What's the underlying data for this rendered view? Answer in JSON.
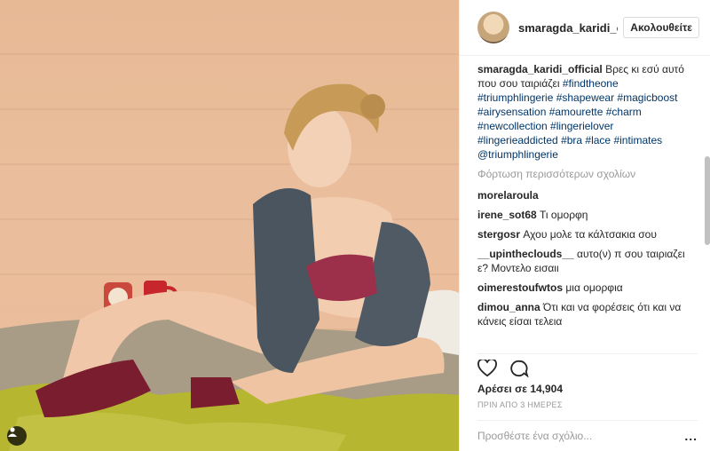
{
  "post": {
    "header": {
      "username": "smaragda_karidi_o",
      "follow_label": "Ακολουθείτε"
    },
    "caption": {
      "username": "smaragda_karidi_official",
      "text": "Βρες κι εσύ αυτό που σου ταιριάζει",
      "tags_line1": "#findtheone",
      "tags_line2": "#triumphlingerie #shapewear #magicboost",
      "tags_line3": "#airysensation #amourette #charm",
      "tags_line4": "#newcollection #lingerielover",
      "tags_line5": "#lingerieaddicted #bra #lace #intimates",
      "tags_line6": "@triumphlingerie"
    },
    "load_more": "Φόρτωση περισσότερων σχολίων",
    "comments": [
      {
        "user": "morelaroula",
        "text": ""
      },
      {
        "user": "irene_sot68",
        "text": "Τι ομορφη"
      },
      {
        "user": "stergosr",
        "text": "Αχου μολε τα κάλτσακια σου"
      },
      {
        "user": "__upintheclouds__",
        "text": "αυτο(ν) π σου ταιριαζει ε? Μοντελο εισαιι"
      },
      {
        "user": "oimerestoufwtos",
        "text": "μια ομορφια"
      },
      {
        "user": "dimou_anna",
        "text": "Ότι και να φορέσεις ότι και να κάνεις είσαι τελεια"
      }
    ],
    "likes": "Αρέσει σε 14,904",
    "time": "ΠΡΙΝ ΑΠΟ 3 ΗΜΕΡΕΣ",
    "add_comment_placeholder": "Προσθέστε ένα σχόλιο...",
    "more_options": "..."
  },
  "icons": {
    "like": "heart-icon",
    "comment": "comment-icon",
    "user_tag": "person-icon"
  },
  "colors": {
    "hashtag": "#003569",
    "muted": "#999999",
    "text": "#262626"
  }
}
